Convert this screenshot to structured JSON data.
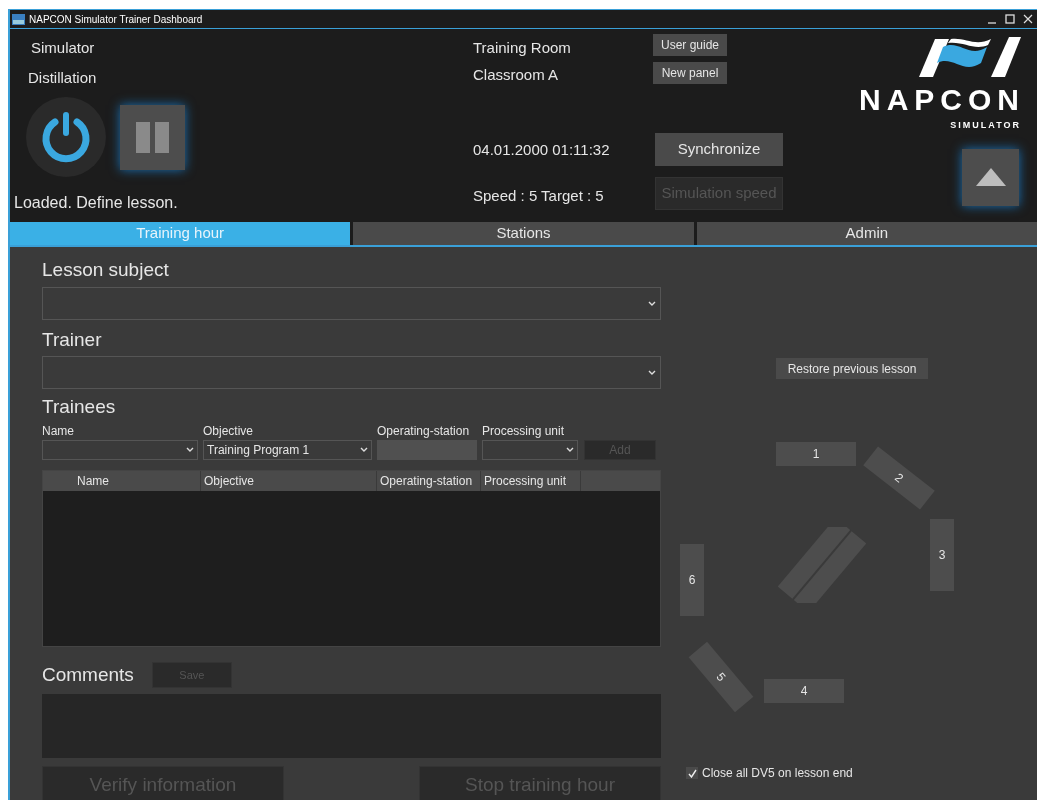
{
  "window": {
    "title": "NAPCON Simulator Trainer Dashboard"
  },
  "header": {
    "simulator_label": "Simulator",
    "simulator_name": "Distillation",
    "status": "Loaded. Define lesson.",
    "room_label": "Training Room",
    "room": "Classroom A",
    "datetime": "04.01.2000 01:11:32",
    "speed": "Speed : 5 Target : 5",
    "logo": {
      "name": "NAPCON",
      "tagline": "SIMULATOR"
    },
    "small_buttons": [
      {
        "label": "User guide",
        "disabled": false
      },
      {
        "label": "New panel",
        "disabled": false
      }
    ],
    "large_buttons": [
      {
        "label": "Synchronize",
        "disabled": false
      },
      {
        "label": "Simulation speed",
        "disabled": true
      }
    ]
  },
  "tabs": [
    {
      "label": "Training hour",
      "selected": true
    },
    {
      "label": "Stations",
      "selected": false
    },
    {
      "label": "Admin",
      "selected": false
    }
  ],
  "lesson_subject": {
    "label": "Lesson subject"
  },
  "trainer": {
    "label": "Trainer"
  },
  "trainees": {
    "label": "Trainees",
    "fields": [
      {
        "label": "Name",
        "kind": "select"
      },
      {
        "label": "Objective",
        "kind": "select",
        "value": "Training Program 1"
      },
      {
        "label": "Operating-station",
        "kind": "text"
      },
      {
        "label": "Processing unit",
        "kind": "select"
      }
    ],
    "add_button": {
      "label": "Add",
      "disabled": true
    },
    "table": {
      "columns": [
        "Name",
        "Objective",
        "Operating-station",
        "Processing unit"
      ]
    }
  },
  "comments": {
    "label": "Comments",
    "save_button": {
      "label": "Save",
      "disabled": true
    }
  },
  "actions": [
    {
      "label": "Verify information",
      "disabled": true
    },
    {
      "label": "Stop training hour",
      "disabled": true
    }
  ],
  "restore_button": {
    "label": "Restore previous lesson",
    "disabled": false
  },
  "stations": [
    {
      "label": "1"
    },
    {
      "label": "2"
    },
    {
      "label": "3"
    },
    {
      "label": "4"
    },
    {
      "label": "5"
    },
    {
      "label": "6"
    }
  ],
  "close_option": {
    "label": "Close all DV5 on lesson end",
    "checked": true
  }
}
